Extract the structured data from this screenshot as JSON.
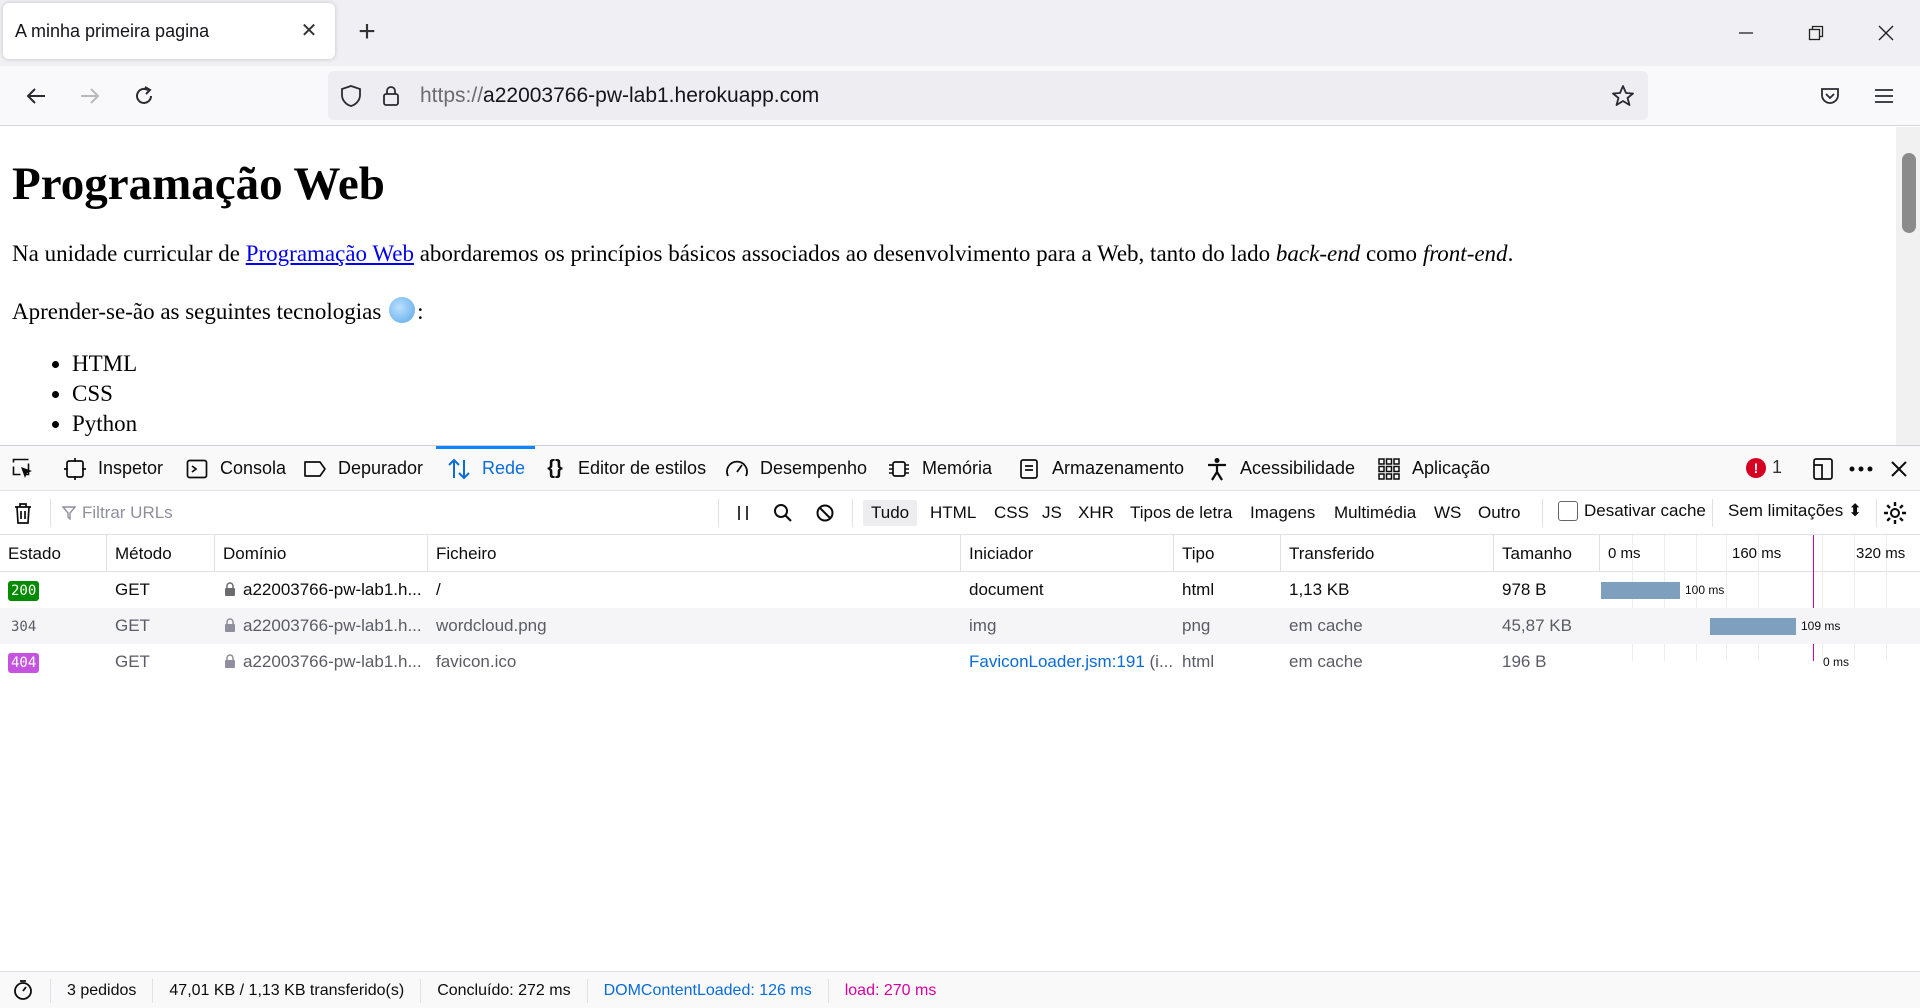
{
  "window": {
    "tab_title": "A minha primeira pagina",
    "close_tab_glyph": "✕",
    "new_tab_glyph": "+"
  },
  "navbar": {
    "url_protocol": "https://",
    "url_host": "a22003766-pw-lab1.herokuapp.com"
  },
  "page": {
    "heading": "Programação Web",
    "intro_before": "Na unidade curricular de ",
    "intro_link": "Programação Web",
    "intro_middle": " abordaremos os princípios básicos associados ao desenvolvimento para a Web, tanto do lado ",
    "intro_em1": "back-end",
    "intro_between": " como ",
    "intro_em2": "front-end",
    "intro_end": ".",
    "tech_intro": "Aprender-se-ão as seguintes tecnologias",
    "tech_colon": ":",
    "technologies": [
      "HTML",
      "CSS",
      "Python"
    ]
  },
  "devtools": {
    "tabs": [
      {
        "label": "Inspetor",
        "icon": "inspector-icon"
      },
      {
        "label": "Consola",
        "icon": "console-icon"
      },
      {
        "label": "Depurador",
        "icon": "debugger-icon"
      },
      {
        "label": "Rede",
        "icon": "network-icon"
      },
      {
        "label": "Editor de estilos",
        "icon": "style-editor-icon"
      },
      {
        "label": "Desempenho",
        "icon": "performance-icon"
      },
      {
        "label": "Memória",
        "icon": "memory-icon"
      },
      {
        "label": "Armazenamento",
        "icon": "storage-icon"
      },
      {
        "label": "Acessibilidade",
        "icon": "accessibility-icon"
      },
      {
        "label": "Aplicação",
        "icon": "application-icon"
      }
    ],
    "selected_tab": "Rede",
    "error_count": "1",
    "error_glyph": "!",
    "filter_placeholder": "Filtrar URLs",
    "type_filters": [
      "Tudo",
      "HTML",
      "CSS",
      "JS",
      "XHR",
      "Tipos de letra",
      "Imagens",
      "Multimédia",
      "WS",
      "Outro"
    ],
    "active_type_filter": "Tudo",
    "disable_cache_label": "Desativar cache",
    "throttle_label": "Sem limitações ⬍",
    "columns": [
      "Estado",
      "Método",
      "Domínio",
      "Ficheiro",
      "Iniciador",
      "Tipo",
      "Transferido",
      "Tamanho"
    ],
    "waterfall_ticks": [
      "0 ms",
      "160 ms",
      "320 ms"
    ],
    "requests": [
      {
        "status": "200",
        "status_color": "#058b00",
        "method": "GET",
        "domain": "a22003766-pw-lab1.h...",
        "file": "/",
        "initiator": "document",
        "initiator_suffix": "",
        "type": "html",
        "transferred": "1,13 KB",
        "size": "978 B",
        "timing_label": "100 ms"
      },
      {
        "status": "304",
        "status_color": "",
        "method": "GET",
        "domain": "a22003766-pw-lab1.h...",
        "file": "wordcloud.png",
        "initiator": "img",
        "initiator_suffix": "",
        "type": "png",
        "transferred": "em cache",
        "size": "45,87 KB",
        "timing_label": "109 ms"
      },
      {
        "status": "404",
        "status_color": "#c553e0",
        "method": "GET",
        "domain": "a22003766-pw-lab1.h...",
        "file": "favicon.ico",
        "initiator": "FaviconLoader.jsm:191",
        "initiator_suffix": " (i...",
        "type": "html",
        "transferred": "em cache",
        "size": "196 B",
        "timing_label": "0 ms"
      }
    ],
    "statusbar": {
      "requests": "3 pedidos",
      "transferred": "47,01 KB / 1,13 KB transferido(s)",
      "finished": "Concluído: 272 ms",
      "dom_content_loaded": "DOMContentLoaded: 126 ms",
      "load": "load: 270 ms"
    },
    "colors": {
      "accent": "#0a84ff",
      "dcl_line": "#0a84ff",
      "load_line": "#d700a0"
    }
  }
}
